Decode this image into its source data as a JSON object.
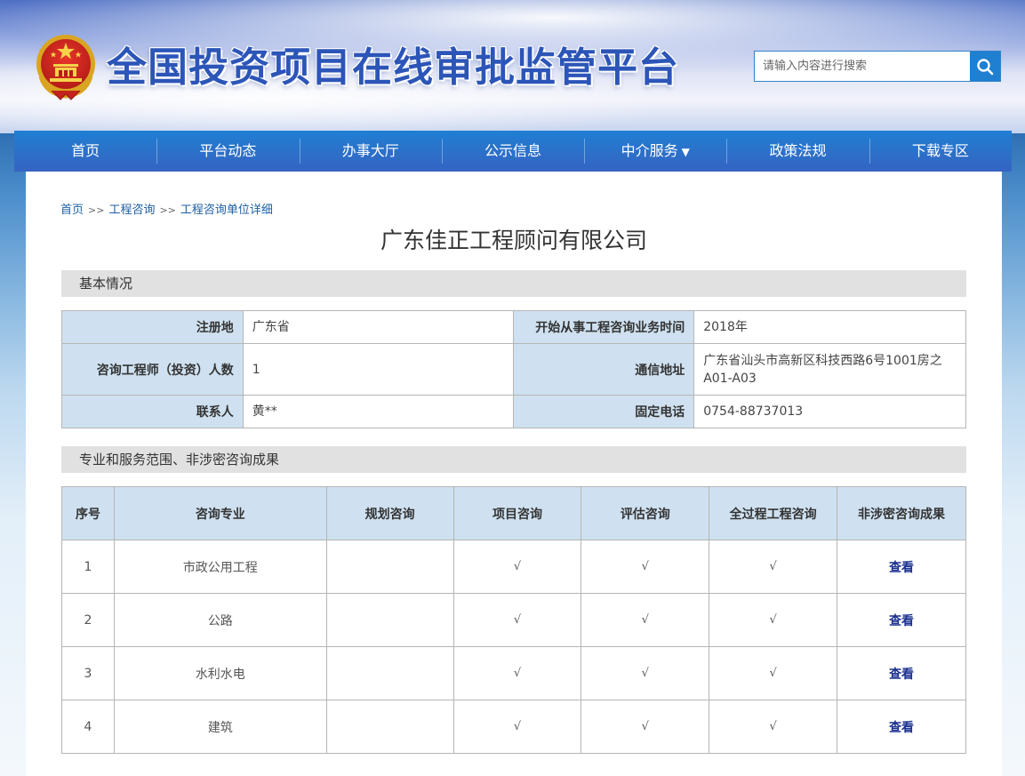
{
  "header": {
    "site_title": "全国投资项目在线审批监管平台",
    "search_placeholder": "请输入内容进行搜索"
  },
  "nav": [
    {
      "label": "首页"
    },
    {
      "label": "平台动态"
    },
    {
      "label": "办事大厅"
    },
    {
      "label": "公示信息"
    },
    {
      "label": "中介服务",
      "caret": "▼"
    },
    {
      "label": "政策法规"
    },
    {
      "label": "下载专区"
    }
  ],
  "breadcrumb": {
    "items": [
      "首页",
      "工程咨询",
      "工程咨询单位详细"
    ],
    "separator": ">>"
  },
  "company": {
    "name": "广东佳正工程顾问有限公司"
  },
  "basic_info": {
    "section_title": "基本情况",
    "rows": [
      {
        "label1": "注册地",
        "value1": "广东省",
        "label2": "开始从事工程咨询业务时间",
        "value2": "2018年"
      },
      {
        "label1": "咨询工程师（投资）人数",
        "value1": "1",
        "label2": "通信地址",
        "value2": "广东省汕头市高新区科技西路6号1001房之A01-A03"
      },
      {
        "label1": "联系人",
        "value1": "黄**",
        "label2": "固定电话",
        "value2": "0754-88737013"
      }
    ]
  },
  "scope": {
    "section_title": "专业和服务范围、非涉密咨询成果",
    "headers": [
      "序号",
      "咨询专业",
      "规划咨询",
      "项目咨询",
      "评估咨询",
      "全过程工程咨询",
      "非涉密咨询成果"
    ],
    "rows": [
      {
        "no": "1",
        "major": "市政公用工程",
        "planning": "",
        "project": "√",
        "evaluation": "√",
        "whole": "√",
        "result": "查看"
      },
      {
        "no": "2",
        "major": "公路",
        "planning": "",
        "project": "√",
        "evaluation": "√",
        "whole": "√",
        "result": "查看"
      },
      {
        "no": "3",
        "major": "水利水电",
        "planning": "",
        "project": "√",
        "evaluation": "√",
        "whole": "√",
        "result": "查看"
      },
      {
        "no": "4",
        "major": "建筑",
        "planning": "",
        "project": "√",
        "evaluation": "√",
        "whole": "√",
        "result": "查看"
      }
    ]
  },
  "colors": {
    "nav_bg": "#2b71c9",
    "table_header_bg": "#cfe1f0",
    "section_bg": "#e1e1e1",
    "link": "#1a2f8f"
  },
  "icons": {
    "emblem": "national-emblem-icon",
    "search": "search-icon"
  }
}
